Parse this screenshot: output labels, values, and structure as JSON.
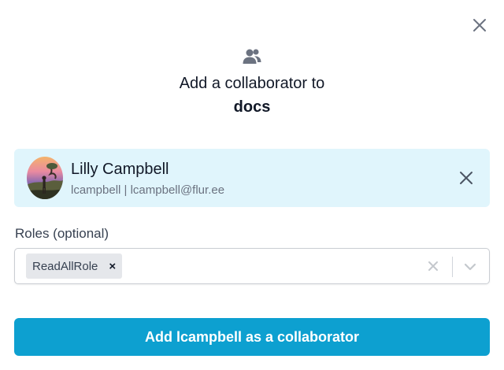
{
  "dialog": {
    "close_icon": "close-icon",
    "header_icon": "users-icon",
    "title": "Add a collaborator to",
    "repo_name": "docs"
  },
  "user": {
    "name": "Lilly Campbell",
    "meta": "lcampbell | lcampbell@flur.ee",
    "remove_icon": "close-icon"
  },
  "roles": {
    "label": "Roles (optional)",
    "selected": [
      {
        "label": "ReadAllRole",
        "remove_glyph": "×"
      }
    ],
    "clear_icon": "clear-icon",
    "dropdown_icon": "chevron-down-icon"
  },
  "submit": {
    "label": "Add lcampbell as a collaborator"
  },
  "colors": {
    "accent": "#0da0d0",
    "card_bg": "#e0f5fc",
    "chip_bg": "#e5e7eb"
  }
}
